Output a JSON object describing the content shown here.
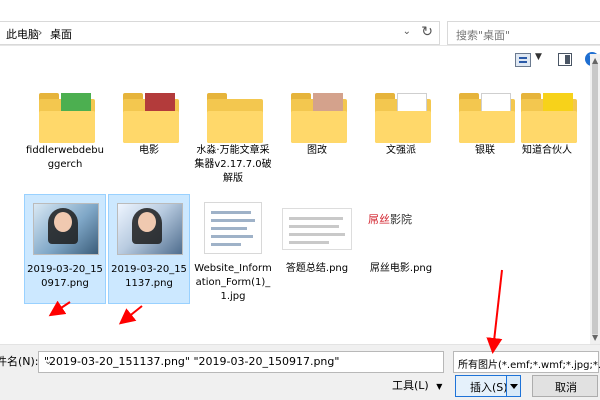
{
  "breadcrumb": {
    "items": [
      "此电脑",
      "桌面"
    ]
  },
  "search": {
    "placeholder": "搜索\"桌面\""
  },
  "toolbar": {
    "help": "?"
  },
  "files": [
    {
      "label": "fiddlerwebdebuggerch",
      "type": "folder",
      "selected": false
    },
    {
      "label": "电影",
      "type": "folder",
      "selected": false
    },
    {
      "label": "水淼·万能文章采集器v2.17.7.0破解版",
      "type": "folder",
      "selected": false
    },
    {
      "label": "图改",
      "type": "folder",
      "selected": false
    },
    {
      "label": "文强派",
      "type": "folder",
      "selected": false
    },
    {
      "label": "银联",
      "type": "folder",
      "selected": false
    },
    {
      "label": "知道合伙人",
      "type": "folder",
      "selected": false
    },
    {
      "label": "2019-03-20_150917.png",
      "type": "photo",
      "selected": true
    },
    {
      "label": "2019-03-20_151137.png",
      "type": "photo",
      "selected": true
    },
    {
      "label": "Website_Information_Form(1)_1.jpg",
      "type": "doc",
      "selected": false
    },
    {
      "label": "答题总结.png",
      "type": "doc",
      "selected": false
    },
    {
      "label": "屌丝电影.png",
      "type": "brand",
      "selected": false
    }
  ],
  "brand_text": {
    "red": "屌丝",
    "dark": "影院"
  },
  "bottom": {
    "filename_label": "件名(N):",
    "filename_value": "\"2019-03-20_151137.png\" \"2019-03-20_150917.png\"",
    "filter_value": "所有图片(*.emf;*.wmf;*.jpg;*.jp",
    "tools_label": "工具(L)",
    "insert_label": "插入(S)",
    "cancel_label": "取消"
  },
  "colors": {
    "selection": "#cce8ff",
    "accent": "#1e73d8",
    "annotation": "#ff0000"
  }
}
